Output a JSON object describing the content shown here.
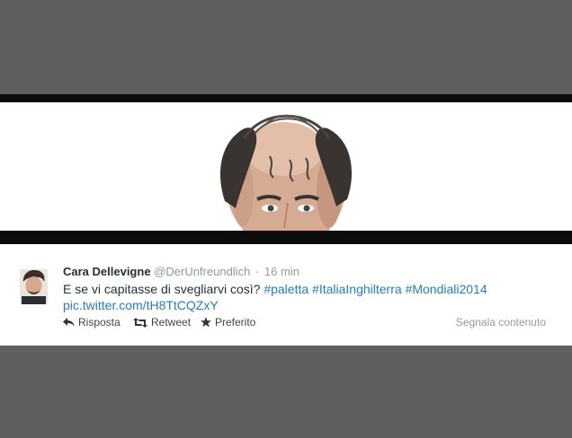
{
  "tweet": {
    "author_name": "Cara Dellevigne",
    "author_handle": "@DerUnfreundlich",
    "separator": "·",
    "timestamp": "16 min",
    "text_prefix": "E se vi capitasse di svegliarvi così?",
    "hashtags": [
      "#paletta",
      "#ItaliaInghilterra",
      "#Mondiali2014"
    ],
    "pic_link": "pic.twitter.com/tH8TtCQZxY"
  },
  "actions": {
    "reply_label": "Risposta",
    "retweet_label": "Retweet",
    "favorite_label": "Preferito",
    "report_label": "Segnala contenuto"
  },
  "icons": {
    "reply": "reply-icon",
    "retweet": "retweet-icon",
    "favorite": "star-icon"
  },
  "colors": {
    "frame_gray": "#5f5f5f",
    "black_bar": "#0c0c0c",
    "link_blue": "#2b7bb9",
    "name_text": "#292f33",
    "muted_text": "#999999"
  }
}
